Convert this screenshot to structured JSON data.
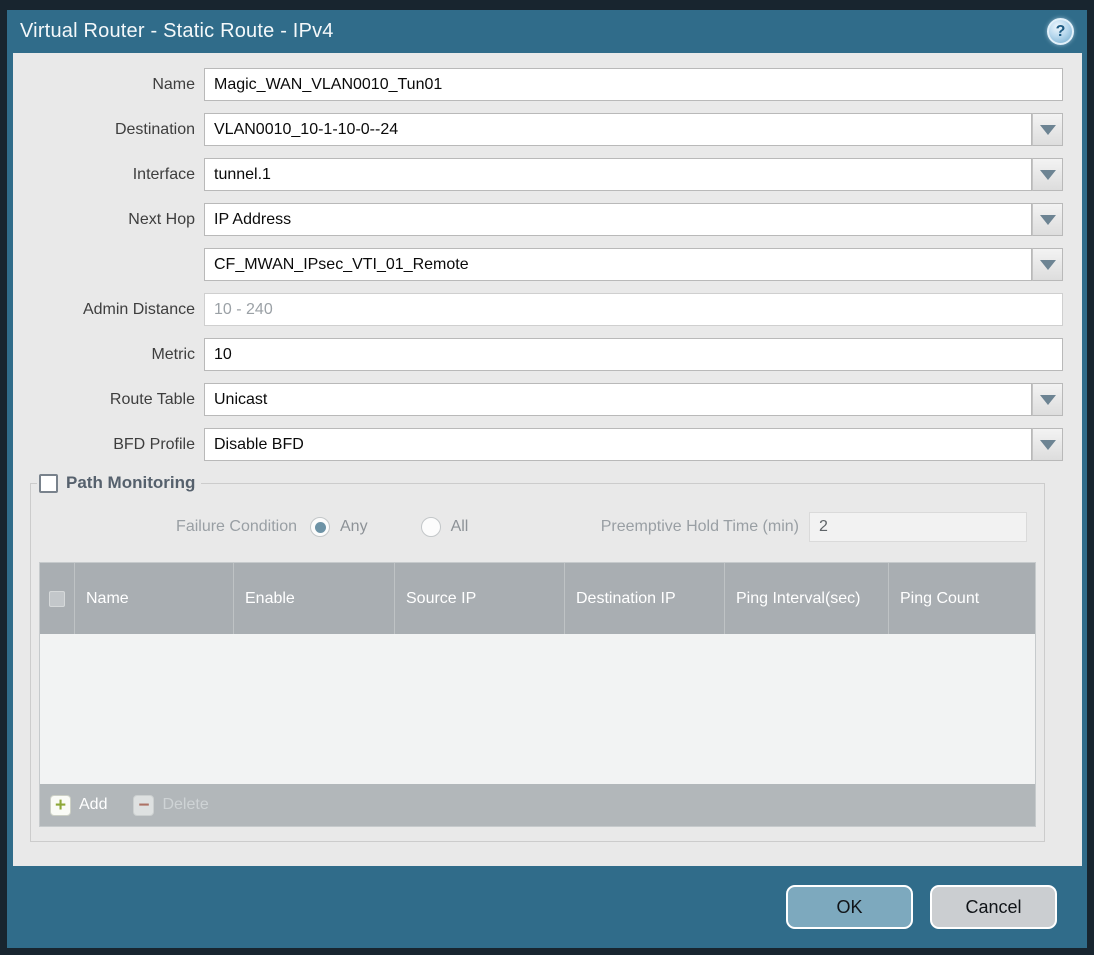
{
  "dialog": {
    "title": "Virtual Router - Static Route - IPv4",
    "help_icon": "help-question-icon",
    "help_glyph": "?"
  },
  "form": {
    "name": {
      "label": "Name",
      "value": "Magic_WAN_VLAN0010_Tun01"
    },
    "destination": {
      "label": "Destination",
      "value": "VLAN0010_10-1-10-0--24"
    },
    "interface": {
      "label": "Interface",
      "value": "tunnel.1"
    },
    "next_hop": {
      "label": "Next Hop",
      "value": "IP Address"
    },
    "next_hop_address": {
      "value": "CF_MWAN_IPsec_VTI_01_Remote"
    },
    "admin_distance": {
      "label": "Admin Distance",
      "placeholder": "10 - 240"
    },
    "metric": {
      "label": "Metric",
      "value": "10"
    },
    "route_table": {
      "label": "Route Table",
      "value": "Unicast"
    },
    "bfd_profile": {
      "label": "BFD Profile",
      "value": "Disable BFD"
    }
  },
  "path_monitoring": {
    "title": "Path Monitoring",
    "checked": false,
    "failure_condition_label": "Failure Condition",
    "option_any": "Any",
    "option_all": "All",
    "selected_option": "Any",
    "preemptive_hold_label": "Preemptive Hold Time (min)",
    "preemptive_hold_value": "2",
    "table": {
      "columns": [
        "Name",
        "Enable",
        "Source IP",
        "Destination IP",
        "Ping Interval(sec)",
        "Ping Count"
      ],
      "rows": []
    },
    "add_label": "Add",
    "delete_label": "Delete"
  },
  "footer": {
    "ok_label": "OK",
    "cancel_label": "Cancel"
  },
  "colors": {
    "chrome_teal": "#306c8a",
    "window_border": "#18252f",
    "panel_bg": "#e9e9e9",
    "table_header_bg": "#a9aeb2",
    "ok_button_bg": "#7da9be",
    "cancel_button_bg": "#cbced1",
    "add_plus_green": "#8ea838",
    "delete_minus_red": "#ad7265",
    "radio_selected_blue": "#6e93a6"
  }
}
